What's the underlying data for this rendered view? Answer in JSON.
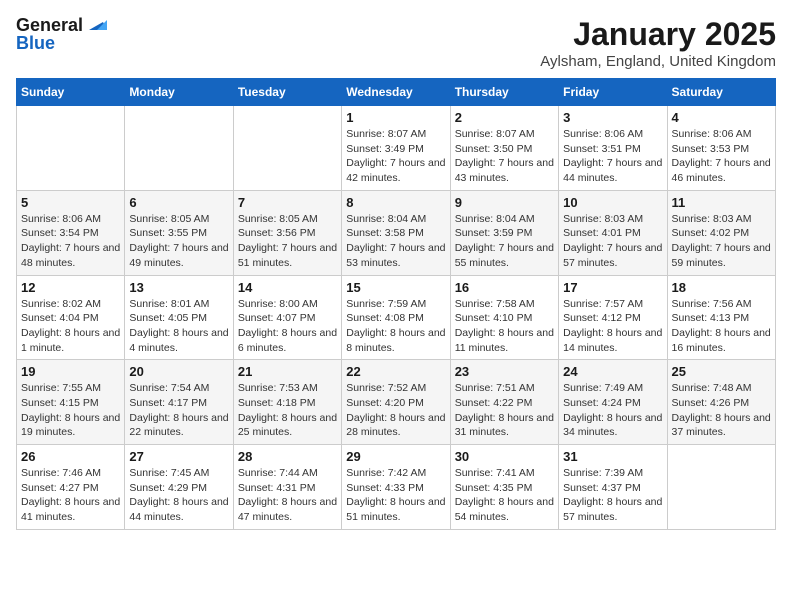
{
  "header": {
    "logo_general": "General",
    "logo_blue": "Blue",
    "title": "January 2025",
    "subtitle": "Aylsham, England, United Kingdom"
  },
  "weekdays": [
    "Sunday",
    "Monday",
    "Tuesday",
    "Wednesday",
    "Thursday",
    "Friday",
    "Saturday"
  ],
  "weeks": [
    [
      {
        "date": "",
        "info": ""
      },
      {
        "date": "",
        "info": ""
      },
      {
        "date": "",
        "info": ""
      },
      {
        "date": "1",
        "info": "Sunrise: 8:07 AM\nSunset: 3:49 PM\nDaylight: 7 hours and 42 minutes."
      },
      {
        "date": "2",
        "info": "Sunrise: 8:07 AM\nSunset: 3:50 PM\nDaylight: 7 hours and 43 minutes."
      },
      {
        "date": "3",
        "info": "Sunrise: 8:06 AM\nSunset: 3:51 PM\nDaylight: 7 hours and 44 minutes."
      },
      {
        "date": "4",
        "info": "Sunrise: 8:06 AM\nSunset: 3:53 PM\nDaylight: 7 hours and 46 minutes."
      }
    ],
    [
      {
        "date": "5",
        "info": "Sunrise: 8:06 AM\nSunset: 3:54 PM\nDaylight: 7 hours and 48 minutes."
      },
      {
        "date": "6",
        "info": "Sunrise: 8:05 AM\nSunset: 3:55 PM\nDaylight: 7 hours and 49 minutes."
      },
      {
        "date": "7",
        "info": "Sunrise: 8:05 AM\nSunset: 3:56 PM\nDaylight: 7 hours and 51 minutes."
      },
      {
        "date": "8",
        "info": "Sunrise: 8:04 AM\nSunset: 3:58 PM\nDaylight: 7 hours and 53 minutes."
      },
      {
        "date": "9",
        "info": "Sunrise: 8:04 AM\nSunset: 3:59 PM\nDaylight: 7 hours and 55 minutes."
      },
      {
        "date": "10",
        "info": "Sunrise: 8:03 AM\nSunset: 4:01 PM\nDaylight: 7 hours and 57 minutes."
      },
      {
        "date": "11",
        "info": "Sunrise: 8:03 AM\nSunset: 4:02 PM\nDaylight: 7 hours and 59 minutes."
      }
    ],
    [
      {
        "date": "12",
        "info": "Sunrise: 8:02 AM\nSunset: 4:04 PM\nDaylight: 8 hours and 1 minute."
      },
      {
        "date": "13",
        "info": "Sunrise: 8:01 AM\nSunset: 4:05 PM\nDaylight: 8 hours and 4 minutes."
      },
      {
        "date": "14",
        "info": "Sunrise: 8:00 AM\nSunset: 4:07 PM\nDaylight: 8 hours and 6 minutes."
      },
      {
        "date": "15",
        "info": "Sunrise: 7:59 AM\nSunset: 4:08 PM\nDaylight: 8 hours and 8 minutes."
      },
      {
        "date": "16",
        "info": "Sunrise: 7:58 AM\nSunset: 4:10 PM\nDaylight: 8 hours and 11 minutes."
      },
      {
        "date": "17",
        "info": "Sunrise: 7:57 AM\nSunset: 4:12 PM\nDaylight: 8 hours and 14 minutes."
      },
      {
        "date": "18",
        "info": "Sunrise: 7:56 AM\nSunset: 4:13 PM\nDaylight: 8 hours and 16 minutes."
      }
    ],
    [
      {
        "date": "19",
        "info": "Sunrise: 7:55 AM\nSunset: 4:15 PM\nDaylight: 8 hours and 19 minutes."
      },
      {
        "date": "20",
        "info": "Sunrise: 7:54 AM\nSunset: 4:17 PM\nDaylight: 8 hours and 22 minutes."
      },
      {
        "date": "21",
        "info": "Sunrise: 7:53 AM\nSunset: 4:18 PM\nDaylight: 8 hours and 25 minutes."
      },
      {
        "date": "22",
        "info": "Sunrise: 7:52 AM\nSunset: 4:20 PM\nDaylight: 8 hours and 28 minutes."
      },
      {
        "date": "23",
        "info": "Sunrise: 7:51 AM\nSunset: 4:22 PM\nDaylight: 8 hours and 31 minutes."
      },
      {
        "date": "24",
        "info": "Sunrise: 7:49 AM\nSunset: 4:24 PM\nDaylight: 8 hours and 34 minutes."
      },
      {
        "date": "25",
        "info": "Sunrise: 7:48 AM\nSunset: 4:26 PM\nDaylight: 8 hours and 37 minutes."
      }
    ],
    [
      {
        "date": "26",
        "info": "Sunrise: 7:46 AM\nSunset: 4:27 PM\nDaylight: 8 hours and 41 minutes."
      },
      {
        "date": "27",
        "info": "Sunrise: 7:45 AM\nSunset: 4:29 PM\nDaylight: 8 hours and 44 minutes."
      },
      {
        "date": "28",
        "info": "Sunrise: 7:44 AM\nSunset: 4:31 PM\nDaylight: 8 hours and 47 minutes."
      },
      {
        "date": "29",
        "info": "Sunrise: 7:42 AM\nSunset: 4:33 PM\nDaylight: 8 hours and 51 minutes."
      },
      {
        "date": "30",
        "info": "Sunrise: 7:41 AM\nSunset: 4:35 PM\nDaylight: 8 hours and 54 minutes."
      },
      {
        "date": "31",
        "info": "Sunrise: 7:39 AM\nSunset: 4:37 PM\nDaylight: 8 hours and 57 minutes."
      },
      {
        "date": "",
        "info": ""
      }
    ]
  ]
}
